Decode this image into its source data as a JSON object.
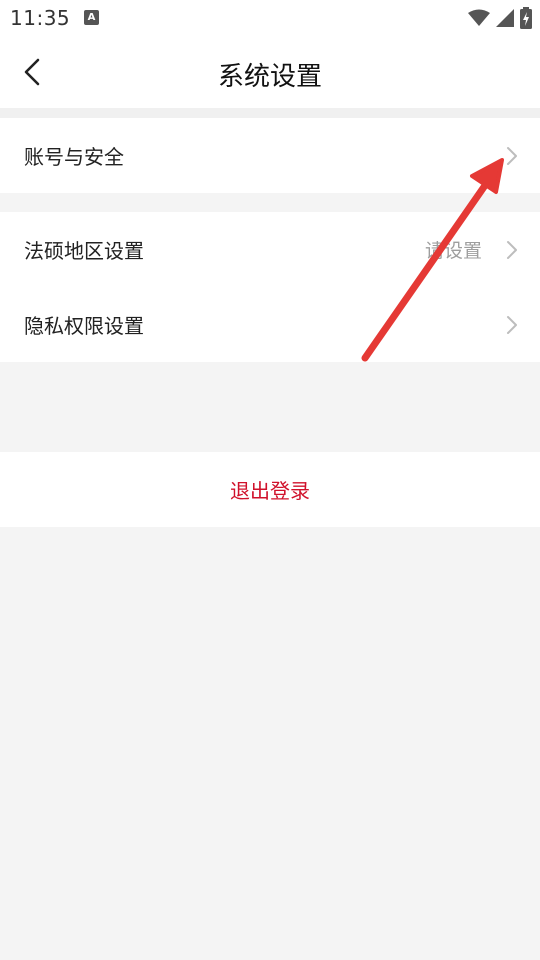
{
  "status_bar": {
    "time": "11:35",
    "notification_icon": "A",
    "icons": [
      "wifi-icon",
      "signal-icon",
      "battery-charging-icon"
    ]
  },
  "header": {
    "title": "系统设置",
    "back_icon": "chevron-left-icon"
  },
  "groups": [
    {
      "items": [
        {
          "label": "账号与安全",
          "value": ""
        }
      ]
    },
    {
      "items": [
        {
          "label": "法硕地区设置",
          "value": "请设置"
        },
        {
          "label": "隐私权限设置",
          "value": ""
        }
      ]
    }
  ],
  "logout": {
    "label": "退出登录"
  },
  "colors": {
    "accent_red": "#d0112b",
    "annotation_arrow": "#e53935",
    "background": "#f4f4f4"
  }
}
